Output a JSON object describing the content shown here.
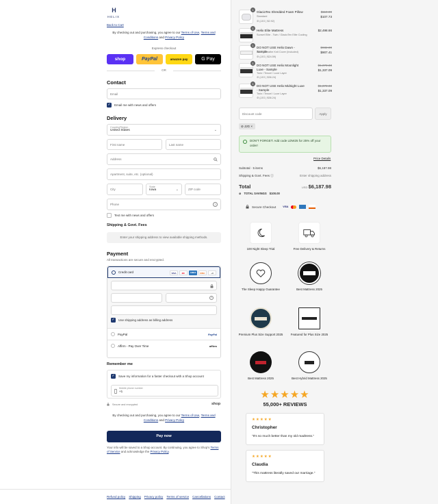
{
  "brand": {
    "mark": "H",
    "name": "HELIX"
  },
  "nav": {
    "back": "Back to Cart"
  },
  "terms": {
    "prefix": "By checking out and purchasing, you agree to our ",
    "tou": "Terms of Use",
    "sep": ", ",
    "terms_conditions": "Terms and Conditions",
    "and": " and ",
    "privacy": "Privacy Policy"
  },
  "express": {
    "label": "Express checkout",
    "shop": "shop",
    "paypal": "PayPal",
    "amazon": "amazon pay",
    "gpay": "G Pay",
    "or": "OR"
  },
  "contact": {
    "heading": "Contact",
    "email_placeholder": "Email",
    "news": "Email me with news and offers"
  },
  "delivery": {
    "heading": "Delivery",
    "country_label": "Country/Region",
    "country": "United States",
    "first": "First name",
    "last": "Last name",
    "address": "Address",
    "apt": "Apartment, suite, etc. (optional)",
    "city": "City",
    "state_label": "State",
    "state": "Iowa",
    "zip": "ZIP code",
    "phone": "Phone",
    "text_me": "Text me with news and offers"
  },
  "shipping": {
    "heading": "Shipping & Govt. Fees",
    "note": "Enter your shipping address to view available shipping methods."
  },
  "payment": {
    "heading": "Payment",
    "sub": "All transactions are secure and encrypted.",
    "credit": "Credit card",
    "card_logos": [
      "VISA",
      "MC",
      "AMEX",
      "DISC",
      "+3"
    ],
    "billing": "Use shipping address as billing address",
    "paypal": "PayPal",
    "affirm": "Affirm - Pay Over Time",
    "paypal_logo": "PayPal",
    "affirm_logo": "affirm"
  },
  "remember": {
    "heading": "Remember me",
    "save": "Save my information for a faster checkout with a Shop account",
    "mobile_label": "Mobile phone number",
    "mobile": "+1",
    "secure": "Secure and encrypted",
    "shop": "shop"
  },
  "pay_now": "Pay now",
  "shop_terms": {
    "text": "Your info will be saved to a Shop account. By continuing, you agree to Shop's ",
    "tos": "Terms of Service",
    "and": " and acknowledge the ",
    "privacy": "Privacy Policy",
    "end": "."
  },
  "footer": [
    "Refund policy",
    "Shipping",
    "Privacy policy",
    "Terms of service",
    "Cancellations",
    "Contact"
  ],
  "cart": {
    "items": [
      {
        "qty": "1",
        "name": "GlacioTex Shredded Foam Pillow",
        "variant": "Standard",
        "discount": "(JJG | $2.92)",
        "old": "$110.00",
        "price": "$107.73"
      },
      {
        "qty": "1",
        "name": "Helix Elite Mattress",
        "variant": "Sunset Elite - Twin / GlacioTex Elite Cooling",
        "discount": "",
        "old": "",
        "price": "$2,498.66"
      },
      {
        "qty": "1",
        "name": "DO NOT USE Helix Dawn - Sample",
        "variant": "Twin / Breathe Knit Cover (Included)",
        "discount": "(JJG | $24.59)",
        "old": "$932.00",
        "price": "$907.41"
      },
      {
        "qty": "1",
        "name": "DO NOT USE Helix Moonlight Luxe - Sample",
        "variant": "Twin / Tencel / Luxe Layer",
        "discount": "(JJG | $36.24)",
        "old": "$1,373.33",
        "price": "$1,337.09"
      },
      {
        "qty": "1",
        "name": "DO NOT USE Helix Midnight Luxe - Sample",
        "variant": "Twin / Tencel / Luxe Layer",
        "discount": "(JJG | $36.24)",
        "old": "$1,373.33",
        "price": "$1,337.09"
      }
    ],
    "discount_placeholder": "Discount code",
    "apply": "Apply",
    "code": "JJG",
    "promo": "DON'T FORGET: Add code LDW25 for 25% off your order!",
    "price_details": "Price Details",
    "subtotal_label": "Subtotal · 5 items",
    "subtotal": "$6,187.98",
    "ship_label": "Shipping & Govt. Fees",
    "ship_value": "Enter shipping address",
    "total_label": "Total",
    "currency": "USD",
    "total": "$6,187.98",
    "savings_label": "TOTAL SAVINGS",
    "savings": "$100.00",
    "secure": "Secure Checkout"
  },
  "features": [
    {
      "label": "100 Night Sleep Trial",
      "icon": "moon-icon"
    },
    {
      "label": "Free Delivery & Returns",
      "icon": "truck-icon"
    },
    {
      "label": "The Sleep Happy Guarantee",
      "icon": "heart-badge-icon"
    },
    {
      "label": "Best Mattress 2025",
      "icon": "award-badge-icon"
    },
    {
      "label": "Premium Plus Size Support 2025",
      "icon": "good-housekeeping-icon"
    },
    {
      "label": "Featured for Plus Size 2025",
      "icon": "wirecutter-icon"
    },
    {
      "label": "Best Mattress 2025",
      "icon": "forbes-icon"
    },
    {
      "label": "Best Hybrid Mattress 2025",
      "icon": "gq-award-icon"
    }
  ],
  "rating": {
    "stars": "★★★★★",
    "count": "55,000+ REVIEWS",
    "value": 5
  },
  "reviews": [
    {
      "stars": "★★★★★",
      "name": "Christopher",
      "text": "\"It's so much better than my old madtress.\""
    },
    {
      "stars": "★★★★★",
      "name": "Claudia",
      "text": "\"This mattress literally saved our marriage.\""
    }
  ],
  "colors": {
    "primary": "#13285a",
    "shop": "#5a31f4",
    "paypal": "#ffc439",
    "amazon": "#ffd814",
    "star": "#f5a623",
    "promo_bg": "#e7f5e4"
  }
}
